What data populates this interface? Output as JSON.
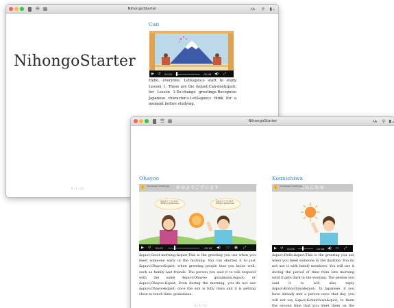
{
  "app": {
    "title": "NihongoStarter",
    "brand": "NihongoStarter"
  },
  "toolbar": {
    "font_size_label": "AA",
    "search_icon": "search-icon",
    "bookmark_icon": "bookmark-icon"
  },
  "window1": {
    "page_indicator": "8 / 1 / 12",
    "lesson": {
      "title": "Can",
      "player_time_elapsed": "00:00",
      "player_time_remaining": "-00:06",
      "text": "Hello, everyone. Let&apos;s start to study Lesson 1. These are the &quot;Can-dos&quot; for Lesson 1.Ex-change greetings.Recognise Japanese character-s.Let&apos;s think for a moment before studying."
    }
  },
  "window2": {
    "left": {
      "title": "Ohayoo",
      "head_label": "Exchange Greetings",
      "head_number": "1",
      "head_jp": "おはようございます",
      "bubble_left": "おはようございます。Ohayoo gozaimasu.",
      "bubble_right": "おはようございます。Ohayoo gozaimasu.",
      "player_time_elapsed": "00:02",
      "player_time_remaining": "-00:18",
      "text": "&quot;Good morning.&quot;This is the greeting you use when you meet someone early in the morning. You can shorten it to just &quot;Ohayoo&quot; when greeting people that you know well, such as family and friends. The person you said it to will respond with the same &quot;Ohayoo gozaimasu.&quot; or &quot;Ohayoo.&quot; Even during the morning, you do not use &quot;Ohayoo&quot; once the sun is fully risen and it is getting close to lunch time. gozaimasu.",
      "page_indicator": "8 / 1 / 12"
    },
    "right": {
      "title": "Konnichiwa",
      "head_label": "Exchange Greetings",
      "head_number": "1",
      "head_jp": "こんにちは",
      "player_time_elapsed": "00:06",
      "player_time_remaining": "-00:06",
      "text": "&quot;Hello.&quot;This is the greeting you use when you meet someone in the daytime. You do not use it with family members. You will use it during the period of time from late morning until it gets dark in the evening. The person you said it to will also reply &quot;Konnichiwa&quot;. In Japanese, if you have already met a person once that day, you will not say &quot;Konnichiwa&quot; to them the second time that you meet them on the same day.",
      "page_indicator": "8 / 1 / 12"
    }
  },
  "colors": {
    "link_blue": "#2e86d6",
    "control_bar": "#0e0e0e",
    "sun": "#f7a13a"
  }
}
